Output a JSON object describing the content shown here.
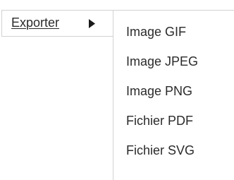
{
  "menu": {
    "parent_label": "Exporter",
    "arrow_icon": "caret-right-icon",
    "submenu_items": [
      {
        "label": "Image GIF"
      },
      {
        "label": "Image JPEG"
      },
      {
        "label": "Image PNG"
      },
      {
        "label": "Fichier PDF"
      },
      {
        "label": "Fichier SVG"
      }
    ]
  },
  "colors": {
    "text": "#2b2b2b",
    "border": "#d2d2d2",
    "background": "#ffffff"
  }
}
